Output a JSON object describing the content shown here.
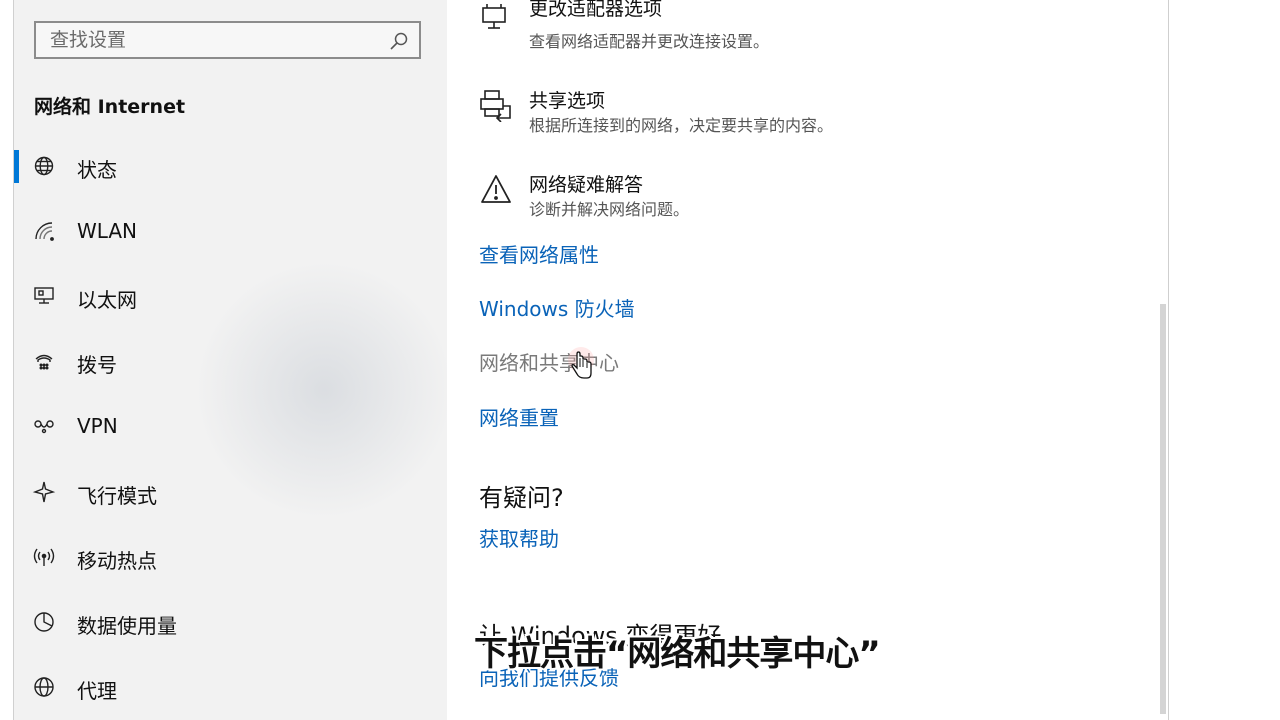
{
  "sidebar": {
    "search_placeholder": "查找设置",
    "section_title": "网络和 Internet",
    "items": [
      {
        "label": "状态",
        "icon": "globe-icon",
        "selected": true
      },
      {
        "label": "WLAN",
        "icon": "wifi-icon",
        "selected": false
      },
      {
        "label": "以太网",
        "icon": "ethernet-icon",
        "selected": false
      },
      {
        "label": "拨号",
        "icon": "dialup-icon",
        "selected": false
      },
      {
        "label": "VPN",
        "icon": "vpn-icon",
        "selected": false
      },
      {
        "label": "飞行模式",
        "icon": "airplane-icon",
        "selected": false
      },
      {
        "label": "移动热点",
        "icon": "hotspot-icon",
        "selected": false
      },
      {
        "label": "数据使用量",
        "icon": "data-usage-icon",
        "selected": false
      },
      {
        "label": "代理",
        "icon": "proxy-globe-icon",
        "selected": false
      }
    ]
  },
  "main": {
    "settings": [
      {
        "title": "更改适配器选项",
        "description": "查看网络适配器并更改连接设置。",
        "icon": "adapter-icon"
      },
      {
        "title": "共享选项",
        "description": "根据所连接到的网络，决定要共享的内容。",
        "icon": "sharing-icon"
      },
      {
        "title": "网络疑难解答",
        "description": "诊断并解决网络问题。",
        "icon": "warning-icon"
      }
    ],
    "links": {
      "view_properties": "查看网络属性",
      "firewall": "Windows 防火墙",
      "sharing_center": "网络和共享中心",
      "network_reset": "网络重置"
    },
    "help": {
      "heading": "有疑问?",
      "get_help": "获取帮助"
    },
    "feedback": {
      "heading": "让 Windows 变得更好",
      "link": "向我们提供反馈"
    }
  },
  "caption": "下拉点击“网络和共享中心”",
  "colors": {
    "accent": "#0078d7",
    "link": "#0a63b8",
    "sidebar_bg": "#f2f2f2"
  }
}
